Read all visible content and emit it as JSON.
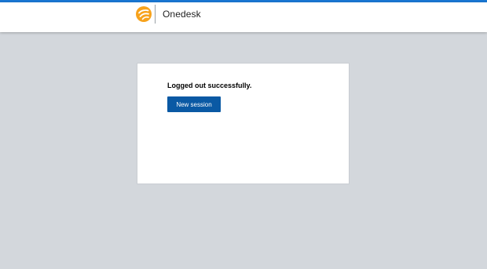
{
  "header": {
    "brand_name": "Onedesk",
    "logo_icon": "turkcell-logo-icon",
    "accent_color": "#1976d2",
    "logo_color": "#f7a21b"
  },
  "card": {
    "message": "Logged out successfully.",
    "new_session_label": "New session",
    "button_color": "#0a59a4"
  }
}
